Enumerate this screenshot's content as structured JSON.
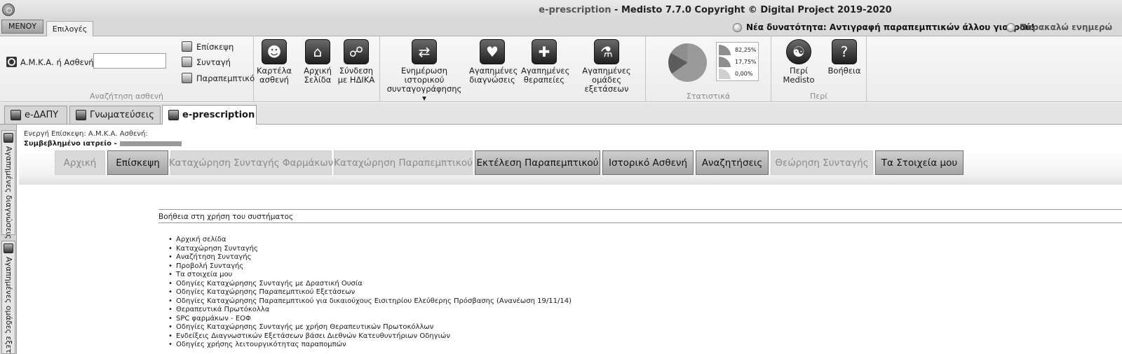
{
  "window": {
    "title_product": "e-prescription",
    "title_rest": " - Medisto 7.7.0 Copyright © Digital Project 2019-2020"
  },
  "topbar": {
    "menu_label": "ΜΕΝΟΥ",
    "options_tab": "Επιλογές",
    "notice_1": "Νέα δυνατότητα: Αντιγραφή παραπεμπτικών άλλου γιατρού!",
    "notice_2": "Παρακαλώ ενημερώ"
  },
  "ribbon": {
    "search": {
      "label": "Α.Μ.Κ.Α. ή Ασθενής",
      "value": "",
      "group_label": "Αναζήτηση ασθενή"
    },
    "small_buttons": [
      "Επίσκεψη",
      "Συνταγή",
      "Παραπεμπτικό"
    ],
    "big_buttons": [
      {
        "line1": "Καρτέλα",
        "line2": "ασθενή"
      },
      {
        "line1": "Αρχική",
        "line2": "Σελίδα"
      },
      {
        "line1": "Σύνδεση",
        "line2": "με ΗΔΙΚΑ"
      },
      {
        "line1": "Ενημέρωση ιστορικού",
        "line2": "συνταγογράφησης ▾"
      },
      {
        "line1": "Αγαπημένες",
        "line2": "διαγνώσεις"
      },
      {
        "line1": "Αγαπημένες",
        "line2": "θεραπείες"
      },
      {
        "line1": "Αγαπημένες",
        "line2": "ομάδες εξετάσεων"
      }
    ],
    "stats": {
      "group_label": "Στατιστικά",
      "values": [
        "82,25%",
        "17,75%",
        "0,00%"
      ]
    },
    "about": {
      "group_label": "Περί",
      "medisto": "Περί Medisto",
      "help": "Βοήθεια"
    }
  },
  "doc_tabs": [
    "e-ΔΑΠΥ",
    "Γνωματεύσεις",
    "e-prescription"
  ],
  "side_tabs": [
    "Αγαπημένες διαγνώσεις",
    "Αγαπημένες ομάδες εξετ"
  ],
  "main": {
    "visit_info": "Ενεργή Επίσκεψη:  Α.Μ.Κ.Α. Ασθενή:",
    "clinic_label": "Συμβεβλημένο ιατρείο -",
    "nav": [
      {
        "label": "Αρχική",
        "state": "light"
      },
      {
        "label": "Επίσκεψη",
        "state": "dark"
      },
      {
        "label": "Καταχώρηση Συνταγής Φαρμάκων",
        "state": "light"
      },
      {
        "label": "Καταχώρηση Παραπεμπτικού",
        "state": "light"
      },
      {
        "label": "Εκτέλεση Παραπεμπτικού",
        "state": "dark"
      },
      {
        "label": "Ιστορικό Ασθενή",
        "state": "dark"
      },
      {
        "label": "Αναζητήσεις",
        "state": "dark"
      },
      {
        "label": "Θεώρηση Συνταγής",
        "state": "light"
      },
      {
        "label": "Τα Στοιχεία μου",
        "state": "dark"
      }
    ],
    "help_title": "Βοήθεια στη χρήση του συστήματος",
    "help_links": [
      "Αρχική σελίδα",
      "Καταχώρηση Συνταγής",
      "Αναζήτηση Συνταγής",
      "Προβολή Συνταγής",
      "Τα στοιχεία μου",
      "Οδηγίες Καταχώρησης Συνταγής με Δραστική Ουσία",
      "Οδηγίες Καταχώρησης Παραπεμπτικού Εξετάσεων",
      "Οδηγίες Καταχώρησης Παραπεμπτικού για δικαιούχους Εισιτηρίου Ελεύθερης Πρόσβασης (Ανανέωση 19/11/14)",
      "Θεραπευτικά Πρωτόκολλα",
      "SPC φαρμάκων - ΕΟΦ",
      "Οδηγίες Καταχώρησης Συνταγής με χρήση Θεραπευτικών Πρωτοκόλλων",
      "Ενδείξεις Διαγνωστικών Εξετάσεων βάσει Διεθνών Κατευθυντήριων Οδηγιών",
      "Οδηγίες χρήσης λειτουργικότητας παραπομπών"
    ]
  }
}
